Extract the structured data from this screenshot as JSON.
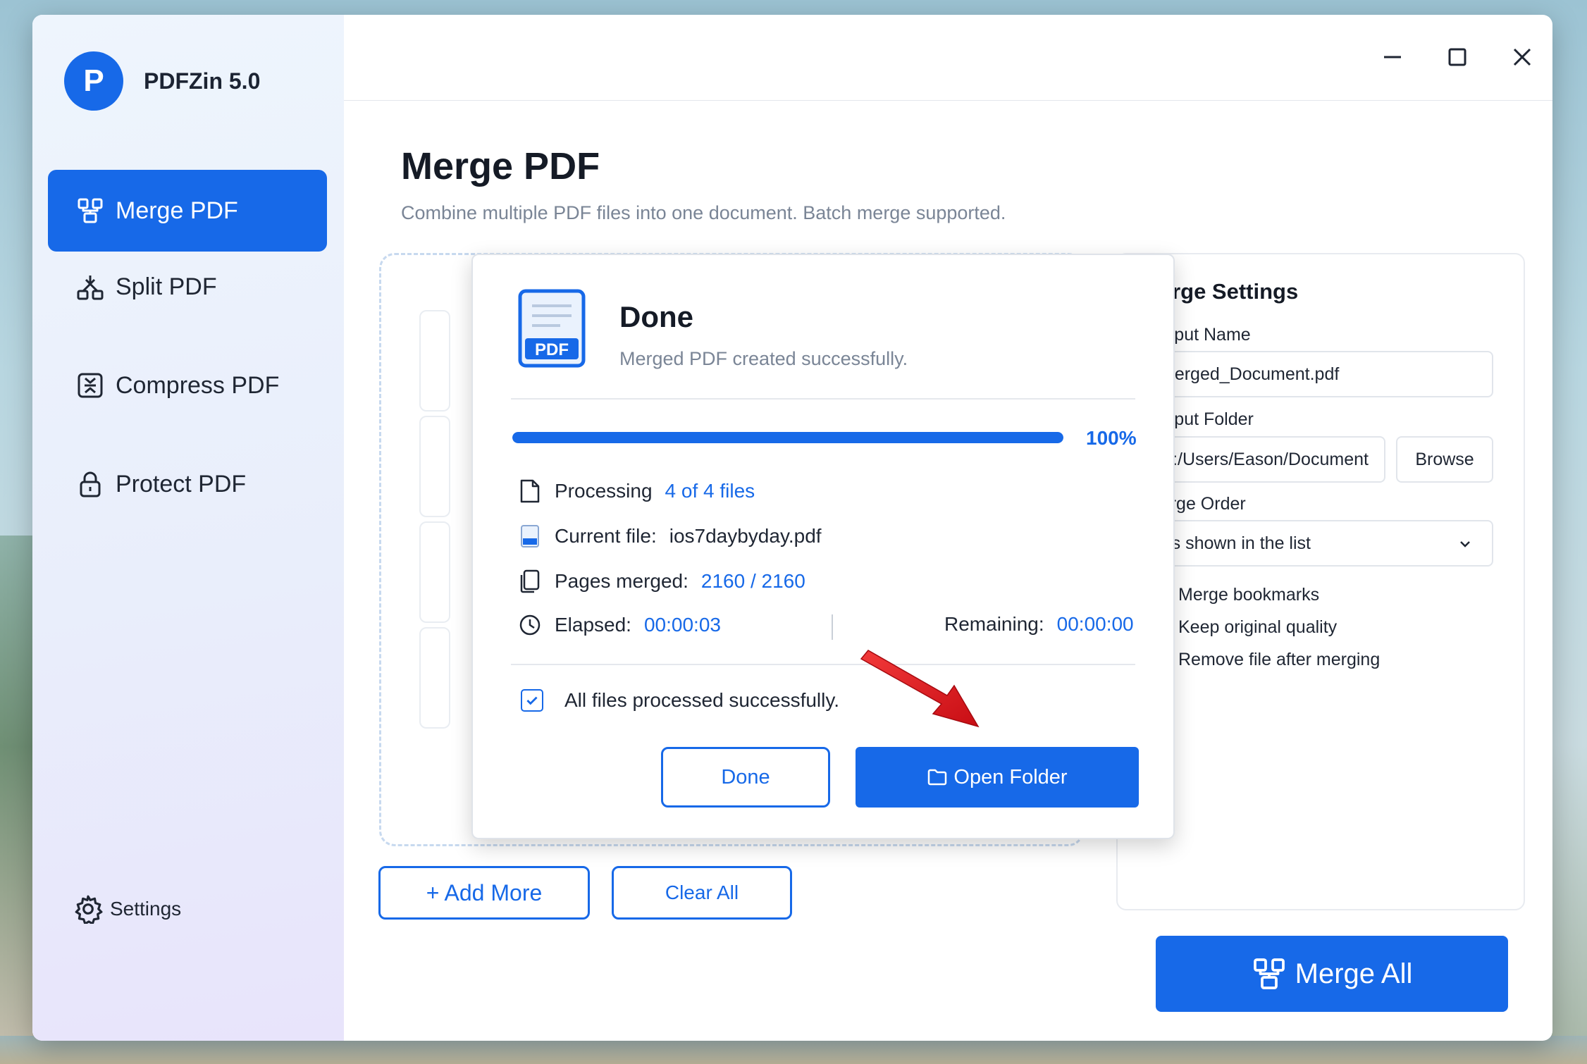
{
  "app": {
    "logo_letter": "P",
    "title": "PDFZin 5.0"
  },
  "sidebar": {
    "items": [
      {
        "label": "Merge PDF",
        "icon": "merge-icon",
        "active": true
      },
      {
        "label": "Split PDF",
        "icon": "split-icon",
        "active": false
      },
      {
        "label": "Compress PDF",
        "icon": "compress-icon",
        "active": false
      },
      {
        "label": "Protect PDF",
        "icon": "lock-icon",
        "active": false
      }
    ],
    "settings_label": "Settings"
  },
  "page": {
    "title": "Merge PDF",
    "subtitle": "Combine multiple PDF files into one document. Batch merge supported."
  },
  "actions": {
    "add_more": "+ Add More",
    "clear_all": "Clear All",
    "merge_all": "Merge All"
  },
  "merge_settings": {
    "title": "Merge Settings",
    "output_name_label": "Output Name",
    "output_name_value": "Merged_Document.pdf",
    "output_folder_label": "Output Folder",
    "output_folder_value": "C:/Users/Eason/Document",
    "browse_label": "Browse",
    "merge_order_label": "Merge Order",
    "merge_order_value": "As shown in the list",
    "options": [
      {
        "label": "Merge bookmarks",
        "checked": true
      },
      {
        "label": "Keep original quality",
        "checked": true
      },
      {
        "label": "Remove file after merging",
        "checked": false
      }
    ]
  },
  "dialog": {
    "icon_text": "PDF",
    "title": "Done",
    "message": "Merged PDF created successfully.",
    "progress_percent": 100,
    "progress_label": "100%",
    "processing_label": "Processing",
    "processing_value": "4 of 4 files",
    "current_file_label": "Current file:",
    "current_file_value": "ios7daybyday.pdf",
    "pages_label": "Pages merged:",
    "pages_value": "2160 / 2160",
    "elapsed_label": "Elapsed:",
    "elapsed_value": "00:00:03",
    "remaining_label": "Remaining:",
    "remaining_value": "00:00:00",
    "status_message": "All files processed successfully.",
    "done_button": "Done",
    "open_folder_button": "Open Folder"
  },
  "colors": {
    "accent": "#1769e8",
    "annotation_arrow": "#e8121b"
  }
}
